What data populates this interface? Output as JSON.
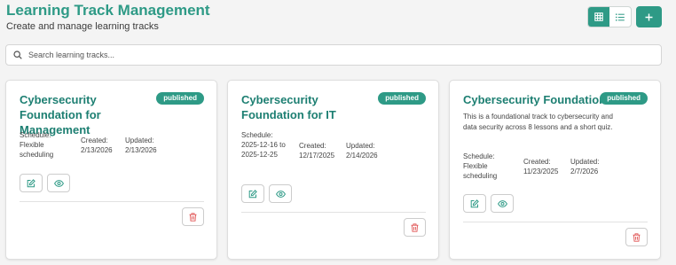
{
  "header": {
    "title": "Learning Track Management",
    "subtitle": "Create and manage learning tracks"
  },
  "toolbar": {
    "grid_icon": "grid-icon",
    "list_icon": "list-icon",
    "add_icon": "plus-icon",
    "active_view": "grid"
  },
  "search": {
    "placeholder": "Search learning tracks...",
    "value": ""
  },
  "colors": {
    "accent": "#2e9a86",
    "title": "#1d7f72",
    "danger": "#e05252"
  },
  "cards": [
    {
      "title": "Cybersecurity Foundation for Management",
      "status": "published",
      "description": "",
      "schedule_label": "Schedule:",
      "schedule_value": "Flexible scheduling",
      "created_label": "Created:",
      "created_value": "2/13/2026",
      "updated_label": "Updated:",
      "updated_value": "2/13/2026"
    },
    {
      "title": "Cybersecurity Foundation for IT",
      "status": "published",
      "description": "",
      "schedule_label": "Schedule:",
      "schedule_value": "2025-12-16 to 2025-12-25",
      "created_label": "Created:",
      "created_value": "12/17/2025",
      "updated_label": "Updated:",
      "updated_value": "2/14/2026"
    },
    {
      "title": "Cybersecurity Foundation",
      "status": "published",
      "description": "This is a foundational track to cybersecurity and data security across 8 lessons and a short quiz.",
      "schedule_label": "Schedule:",
      "schedule_value": "Flexible scheduling",
      "created_label": "Created:",
      "created_value": "11/23/2025",
      "updated_label": "Updated:",
      "updated_value": "2/7/2026"
    }
  ]
}
